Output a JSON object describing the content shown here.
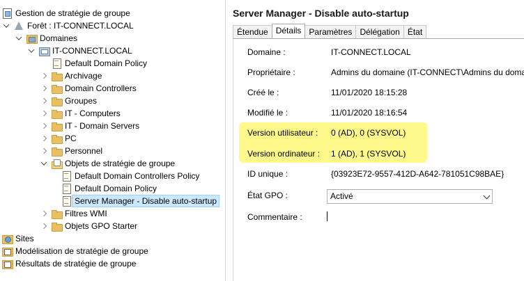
{
  "tree": {
    "items": [
      {
        "label": "Gestion de stratégie de groupe",
        "icon": "gpm-icon",
        "depth": 0,
        "arrow": "none"
      },
      {
        "label": "Forêt : IT-CONNECT.LOCAL",
        "icon": "forest-icon",
        "depth": 0,
        "arrow": "expanded"
      },
      {
        "label": "Domaines",
        "icon": "domains-icon",
        "depth": 1,
        "arrow": "expanded"
      },
      {
        "label": "IT-CONNECT.LOCAL",
        "icon": "domain-icon",
        "depth": 2,
        "arrow": "expanded"
      },
      {
        "label": "Default Domain Policy",
        "icon": "gpo-doc-icon",
        "depth": 3,
        "arrow": "none"
      },
      {
        "label": "Archivage",
        "icon": "folder-icon",
        "depth": 3,
        "arrow": "collapsed"
      },
      {
        "label": "Domain Controllers",
        "icon": "folder-icon",
        "depth": 3,
        "arrow": "collapsed"
      },
      {
        "label": "Groupes",
        "icon": "folder-icon",
        "depth": 3,
        "arrow": "collapsed"
      },
      {
        "label": "IT - Computers",
        "icon": "folder-icon",
        "depth": 3,
        "arrow": "collapsed"
      },
      {
        "label": "IT - Domain Servers",
        "icon": "folder-icon",
        "depth": 3,
        "arrow": "collapsed"
      },
      {
        "label": "PC",
        "icon": "folder-icon",
        "depth": 3,
        "arrow": "collapsed"
      },
      {
        "label": "Personnel",
        "icon": "folder-icon",
        "depth": 3,
        "arrow": "collapsed"
      },
      {
        "label": "Objets de stratégie de groupe",
        "icon": "gpo-folder-icon",
        "depth": 3,
        "arrow": "expanded"
      },
      {
        "label": "Default Domain Controllers Policy",
        "icon": "gpo-doc-icon",
        "depth": 4,
        "arrow": "none"
      },
      {
        "label": "Default Domain Policy",
        "icon": "gpo-doc-icon",
        "depth": 4,
        "arrow": "none"
      },
      {
        "label": "Server Manager - Disable auto-startup",
        "icon": "gpo-doc-icon",
        "depth": 4,
        "arrow": "none",
        "selected": true
      },
      {
        "label": "Filtres WMI",
        "icon": "folder-icon",
        "depth": 3,
        "arrow": "collapsed"
      },
      {
        "label": "Objets GPO Starter",
        "icon": "folder-icon",
        "depth": 3,
        "arrow": "collapsed"
      },
      {
        "label": "Sites",
        "icon": "sites-icon",
        "depth": 0,
        "arrow": "none"
      },
      {
        "label": "Modélisation de stratégie de groupe",
        "icon": "model-icon",
        "depth": 0,
        "arrow": "none"
      },
      {
        "label": "Résultats de stratégie de groupe",
        "icon": "model-icon",
        "depth": 0,
        "arrow": "none"
      }
    ]
  },
  "detail": {
    "title": "Server Manager - Disable auto-startup",
    "tabs": [
      "Étendue",
      "Détails",
      "Paramètres",
      "Délégation",
      "État"
    ],
    "active_tab": "Détails",
    "fields": [
      {
        "label": "Domaine :",
        "value": "IT-CONNECT.LOCAL"
      },
      {
        "label": "Propriétaire :",
        "value": "Admins du domaine (IT-CONNECT\\Admins du domaine)"
      },
      {
        "label": "Créé le :",
        "value": "11/01/2020 18:15:28"
      },
      {
        "label": "Modifié le :",
        "value": "11/01/2020 18:16:54"
      },
      {
        "label": "Version utilisateur :",
        "value": "0 (AD), 0 (SYSVOL)"
      },
      {
        "label": "Version ordinateur :",
        "value": "1 (AD), 1 (SYSVOL)"
      },
      {
        "label": "ID unique :",
        "value": "{03923E72-9557-412D-A642-781051C98BAE}"
      }
    ],
    "gpo_status_label": "État GPO :",
    "gpo_status_value": "Activé",
    "comment_label": "Commentaire :",
    "highlight_color": "#fff88a"
  }
}
